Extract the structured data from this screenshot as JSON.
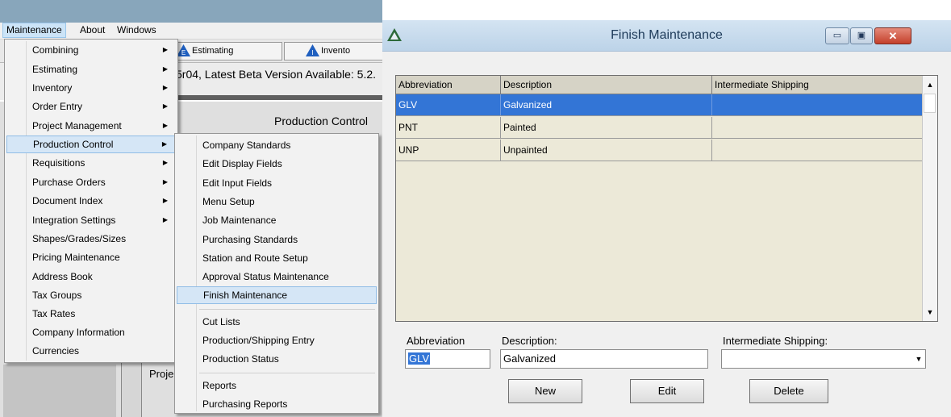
{
  "menubar": {
    "items": [
      "Maintenance",
      "About",
      "Windows"
    ]
  },
  "app_tabs": [
    {
      "label": "Estimating",
      "icon": "estimating-app-icon"
    },
    {
      "label": "Invento",
      "icon": "inventory-app-icon"
    }
  ],
  "version_text": "5r04, Latest Beta Version Available: 5.2.",
  "panel_title": "Production Control",
  "project_label": "Proje",
  "maintenance_menu": {
    "items": [
      {
        "label": "Combining",
        "submenu": true
      },
      {
        "label": "Estimating",
        "submenu": true
      },
      {
        "label": "Inventory",
        "submenu": true
      },
      {
        "label": "Order Entry",
        "submenu": true
      },
      {
        "label": "Project Management",
        "submenu": true
      },
      {
        "label": "Production Control",
        "submenu": true,
        "highlighted": true
      },
      {
        "label": "Requisitions",
        "submenu": true
      },
      {
        "label": "Purchase Orders",
        "submenu": true
      },
      {
        "label": "Document Index",
        "submenu": true
      },
      {
        "label": "Integration Settings",
        "submenu": true
      },
      {
        "label": "Shapes/Grades/Sizes",
        "submenu": false
      },
      {
        "label": "Pricing Maintenance",
        "submenu": false
      },
      {
        "label": "Address Book",
        "submenu": false
      },
      {
        "label": "Tax Groups",
        "submenu": false
      },
      {
        "label": "Tax Rates",
        "submenu": false
      },
      {
        "label": "Company Information",
        "submenu": false
      },
      {
        "label": "Currencies",
        "submenu": false
      }
    ]
  },
  "production_control_menu": {
    "group1": [
      "Company Standards",
      "Edit Display Fields",
      "Edit Input Fields",
      "Menu Setup",
      "Job Maintenance",
      "Purchasing Standards",
      "Station and Route Setup",
      "Approval Status Maintenance",
      "Finish Maintenance"
    ],
    "group2": [
      "Cut Lists",
      "Production/Shipping Entry",
      "Production Status"
    ],
    "group3": [
      "Reports",
      "Purchasing Reports"
    ],
    "highlighted": "Finish Maintenance"
  },
  "dialog": {
    "title": "Finish Maintenance",
    "window_buttons": {
      "minimize": "▭",
      "maximize": "▣",
      "close": "✕"
    },
    "grid": {
      "columns": [
        "Abbreviation",
        "Description",
        "Intermediate Shipping"
      ],
      "rows": [
        {
          "abbreviation": "GLV",
          "description": "Galvanized",
          "intermediate_shipping": "",
          "selected": true
        },
        {
          "abbreviation": "PNT",
          "description": "Painted",
          "intermediate_shipping": "",
          "selected": false
        },
        {
          "abbreviation": "UNP",
          "description": "Unpainted",
          "intermediate_shipping": "",
          "selected": false
        }
      ]
    },
    "form": {
      "abbreviation_label": "Abbreviation",
      "abbreviation_value": "GLV",
      "description_label": "Description:",
      "description_value": "Galvanized",
      "shipping_label": "Intermediate Shipping:",
      "shipping_value": ""
    },
    "buttons": {
      "new": "New",
      "edit": "Edit",
      "delete": "Delete"
    }
  },
  "colors": {
    "selection": "#3375d6",
    "menu_highlight": "#d5e6f6",
    "grid_background": "#ece9d8",
    "title_bar": "#c7dbed"
  }
}
